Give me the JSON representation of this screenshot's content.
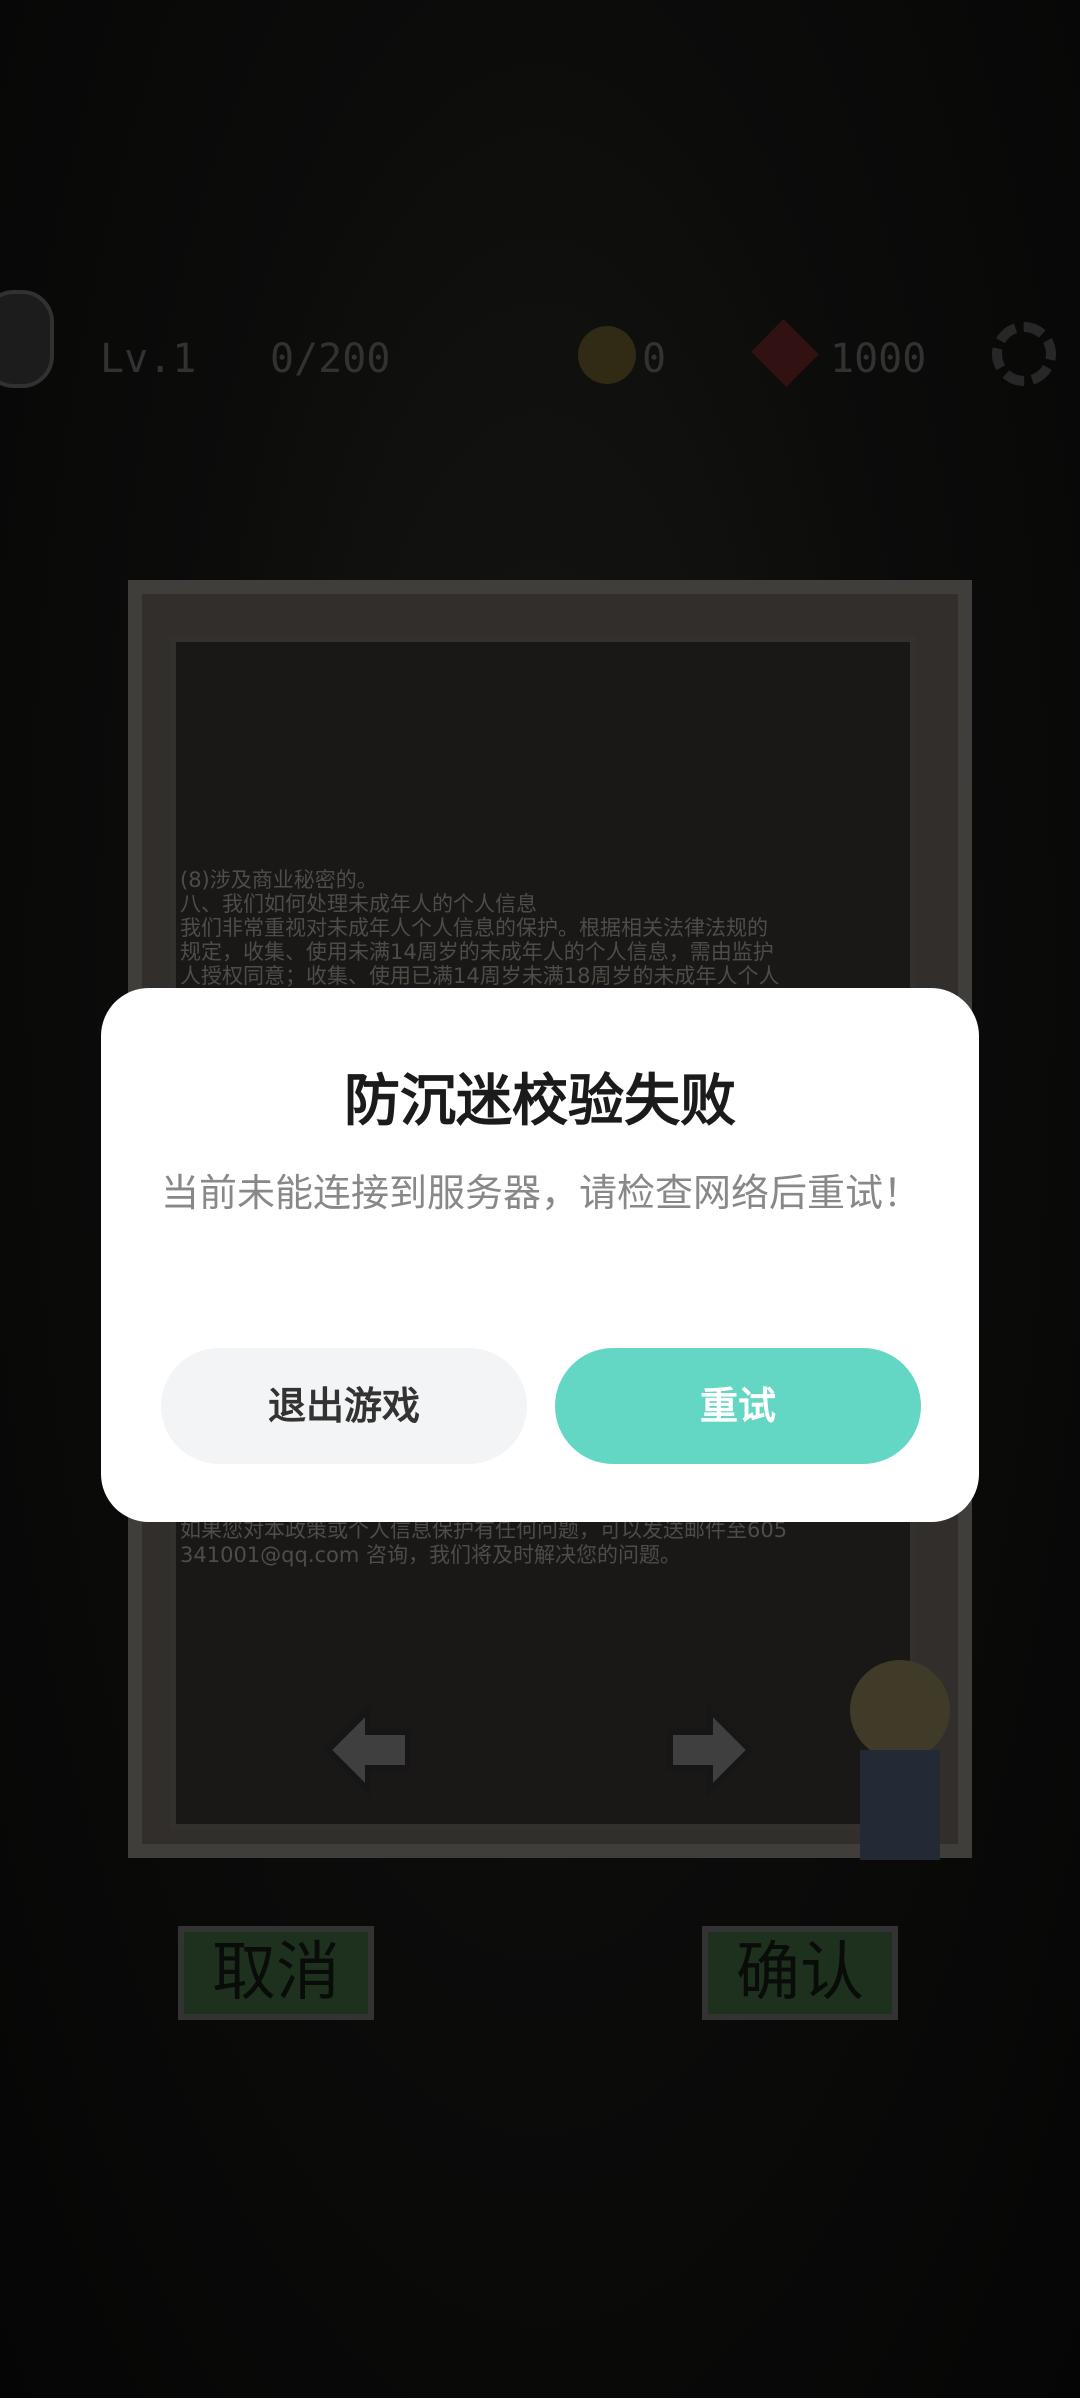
{
  "hud": {
    "level": "Lv.1",
    "exp": "0/200",
    "coins": "0",
    "hp": "1000"
  },
  "panel": {
    "lines": [
      "(8)涉及商业秘密的。",
      "八、我们如何处理未成年人的个人信息",
      "我们非常重视对未成年人个人信息的保护。根据相关法律法规的",
      "规定，收集、使用未满14周岁的未成年人的个人信息，需由监护",
      "人授权同意；收集、使用已满14周岁未满18周岁的未成年人个人"
    ],
    "contact_lines": [
      "如果您对本政策或个人信息保护有任何问题，可以发送邮件至605",
      "341001@qq.com 咨询，我们将及时解决您的问题。"
    ]
  },
  "bottom": {
    "cancel_label": "取消",
    "confirm_label": "确认"
  },
  "dialog": {
    "title": "防沉迷校验失败",
    "message": "当前未能连接到服务器，请检查网络后重试！",
    "exit_label": "退出游戏",
    "retry_label": "重试"
  },
  "colors": {
    "retry_accent": "#64d6c4",
    "exit_bg": "#f3f4f5"
  }
}
